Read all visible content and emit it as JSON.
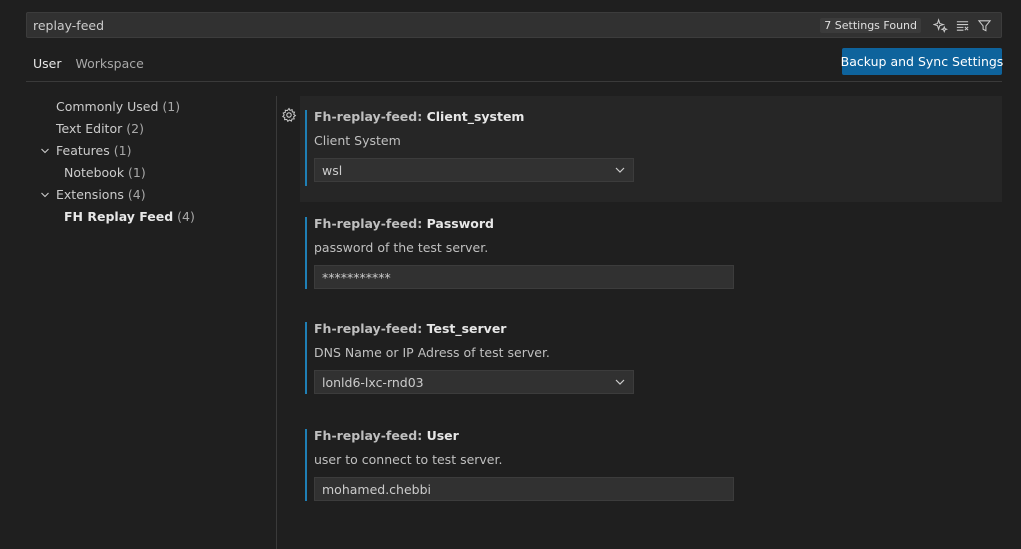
{
  "search": {
    "query": "replay-feed",
    "results_badge": "7 Settings Found"
  },
  "tabs": [
    {
      "label": "User",
      "active": true
    },
    {
      "label": "Workspace",
      "active": false
    }
  ],
  "sync_button": "Backup and Sync Settings",
  "toc": [
    {
      "label": "Commonly Used",
      "count": "(1)"
    },
    {
      "label": "Text Editor",
      "count": "(2)"
    },
    {
      "label": "Features",
      "count": "(1)"
    },
    {
      "label": "Notebook",
      "count": "(1)"
    },
    {
      "label": "Extensions",
      "count": "(4)"
    },
    {
      "label": "FH Replay Feed",
      "count": "(4)"
    }
  ],
  "settings": [
    {
      "category": "Fh-replay-feed: ",
      "key": "Client_system",
      "description": "Client System",
      "value": "wsl"
    },
    {
      "category": "Fh-replay-feed: ",
      "key": "Password",
      "description": "password of the test server.",
      "value": "***********"
    },
    {
      "category": "Fh-replay-feed: ",
      "key": "Test_server",
      "description": "DNS Name or IP Adress of test server.",
      "value": "lonld6-lxc-rnd03"
    },
    {
      "category": "Fh-replay-feed: ",
      "key": "User",
      "description": "user to connect to test server.",
      "value": "mohamed.chebbi"
    }
  ],
  "colors": {
    "accent": "#0e639c",
    "focus_bar": "#1f7fb5",
    "background": "#1f1f1f"
  }
}
